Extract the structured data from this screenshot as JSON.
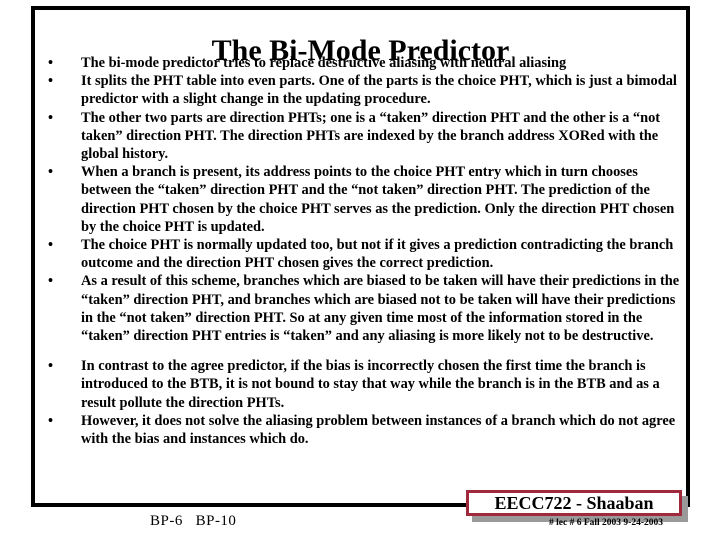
{
  "slide": {
    "title": "The Bi-Mode Predictor",
    "bullet_marker": "•",
    "bullets": [
      {
        "text": "The bi-mode predictor tries to replace destructive aliasing with neutral aliasing",
        "extra_space_before": false
      },
      {
        "text": "It splits the PHT table into even parts. One of the parts is the choice PHT, which is just a bimodal predictor with a slight change in the updating procedure.",
        "extra_space_before": false
      },
      {
        "text": "The other two parts are direction PHTs; one is a “taken” direction PHT and the other is a “not taken” direction PHT. The direction PHTs are indexed by the branch address XORed with the global history.",
        "extra_space_before": false
      },
      {
        "text": "When a branch is present, its address points to the choice PHT entry which in turn chooses between the “taken” direction PHT and the “not taken” direction PHT. The prediction of the direction PHT chosen by the choice PHT serves as the prediction. Only the direction PHT chosen by the choice PHT is updated.",
        "extra_space_before": false
      },
      {
        "text": "The choice PHT is normally updated too, but not if it gives a prediction contradicting the branch outcome and the direction PHT chosen gives the correct prediction.",
        "extra_space_before": false
      },
      {
        "text": "As a result of this scheme, branches which are biased to be taken will have their predictions in the “taken” direction PHT, and branches which are biased not to be taken will have their predictions in the “not taken” direction PHT. So at any given time most of the information stored in the “taken” direction PHT entries is “taken” and any aliasing is more likely not to be destructive.",
        "extra_space_before": false
      },
      {
        "text": "In contrast to the agree predictor, if the bias is incorrectly chosen the first time the branch is introduced to the BTB, it is not bound to stay that way while the branch is in the BTB and as a result pollute the direction PHTs.",
        "extra_space_before": true
      },
      {
        "text": "However, it does not solve the aliasing problem between instances of a branch which do not agree with the bias and instances which do.",
        "extra_space_before": false
      }
    ]
  },
  "footer": {
    "page_number": "BP-6   BP-10",
    "course_badge": "EECC722 - Shaaban",
    "course_meta": "#  lec # 6    Fall 2003    9-24-2003",
    "badge_border_color": "#a02a3c",
    "badge_shadow_color": "#9a9a9a"
  }
}
